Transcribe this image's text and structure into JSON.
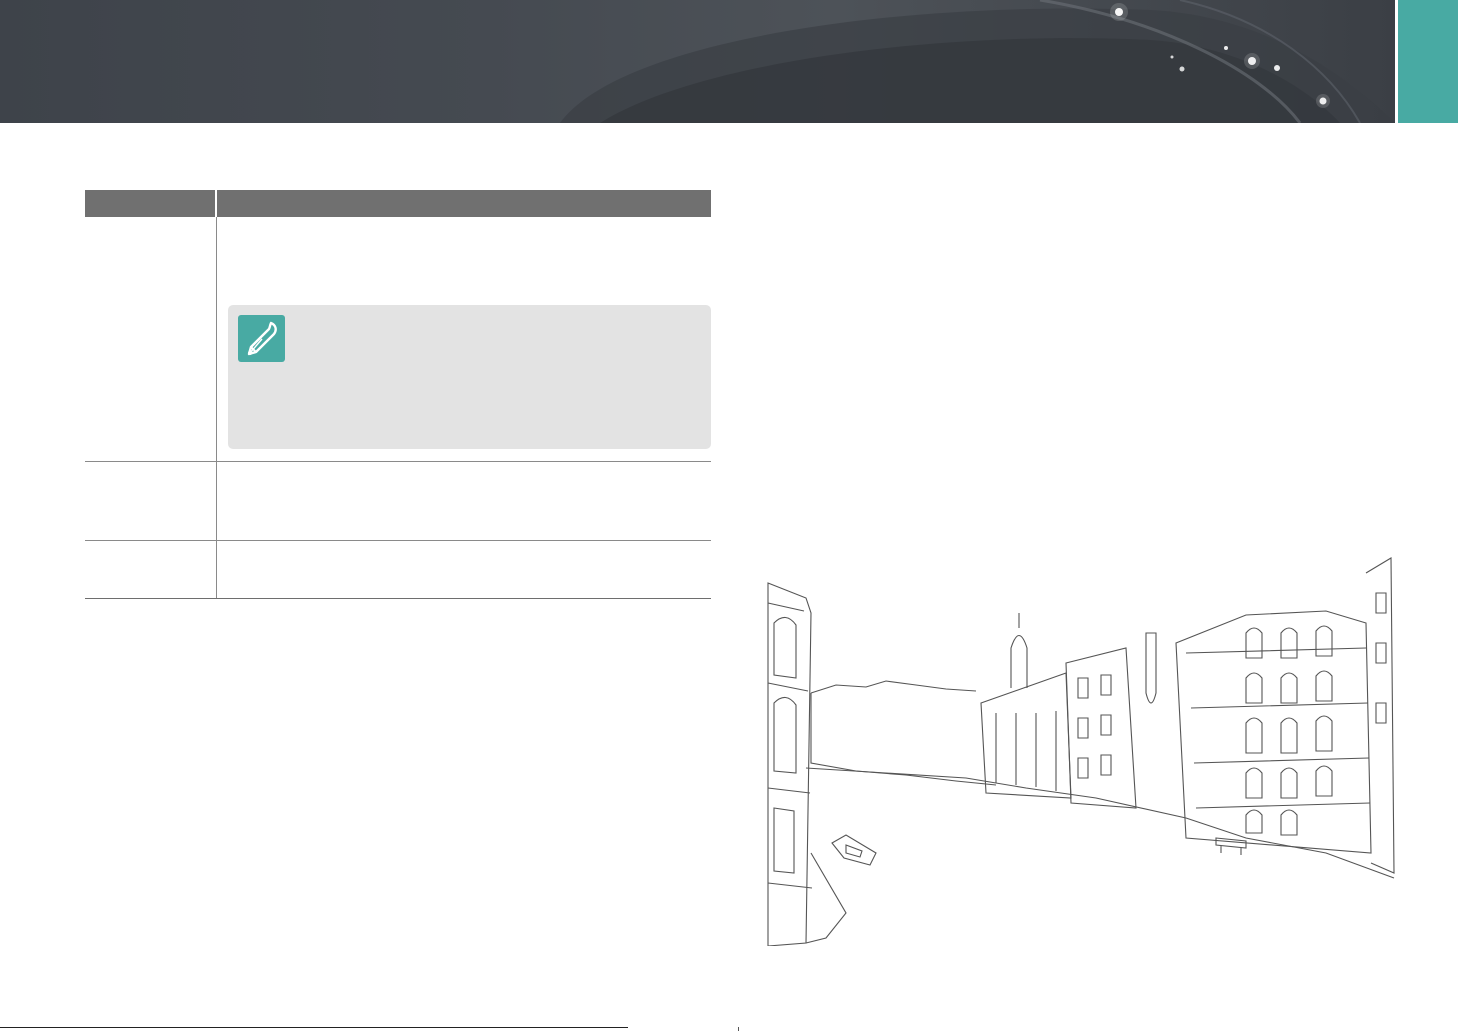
{
  "header": {
    "accent_color": "#48aaa3",
    "banner_color": "#454a51"
  },
  "table": {
    "columns": [],
    "rows": []
  },
  "note": {
    "icon": "pen-icon"
  },
  "illustration": {
    "icon": "city-canal-illustration"
  }
}
